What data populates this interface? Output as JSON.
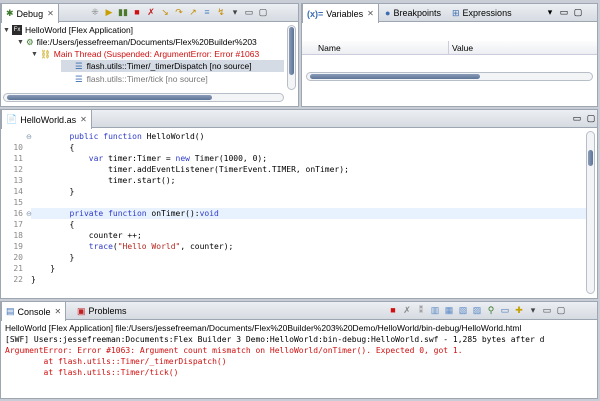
{
  "debug": {
    "tab": "Debug",
    "tree": [
      {
        "text": "HelloWorld [Flex Application]"
      },
      {
        "text": "file:/Users/jessefreeman/Documents/Flex%20Builder%203"
      },
      {
        "text": "Main Thread (Suspended: ArgumentError: Error #1063"
      },
      {
        "text": "flash.utils::Timer/_timerDispatch [no source]"
      },
      {
        "text": "flash.utils::Timer/tick [no source]"
      }
    ]
  },
  "vars": {
    "tabs": [
      "Variables",
      "Breakpoints",
      "Expressions"
    ],
    "col_name": "Name",
    "col_value": "Value"
  },
  "editor": {
    "tab": "HelloWorld.as",
    "lines": [
      {
        "n": "",
        "segs": [
          {
            "t": "        ",
            "c": ""
          },
          {
            "t": "public",
            "c": "kw"
          },
          {
            "t": " ",
            "c": ""
          },
          {
            "t": "function",
            "c": "kw"
          },
          {
            "t": " HelloWorld()",
            "c": ""
          }
        ]
      },
      {
        "n": "10",
        "segs": [
          {
            "t": "        {",
            "c": ""
          }
        ]
      },
      {
        "n": "11",
        "segs": [
          {
            "t": "            ",
            "c": ""
          },
          {
            "t": "var",
            "c": "kw"
          },
          {
            "t": " timer:Timer = ",
            "c": ""
          },
          {
            "t": "new",
            "c": "kw"
          },
          {
            "t": " Timer(1000, 0);",
            "c": ""
          }
        ]
      },
      {
        "n": "12",
        "segs": [
          {
            "t": "                timer.addEventListener(TimerEvent.TIMER, onTimer);",
            "c": ""
          }
        ]
      },
      {
        "n": "13",
        "segs": [
          {
            "t": "                timer.start();",
            "c": ""
          }
        ]
      },
      {
        "n": "14",
        "segs": [
          {
            "t": "        }",
            "c": ""
          }
        ]
      },
      {
        "n": "15",
        "segs": [
          {
            "t": "",
            "c": ""
          }
        ]
      },
      {
        "n": "16",
        "segs": [
          {
            "t": "        ",
            "c": ""
          },
          {
            "t": "private",
            "c": "kw"
          },
          {
            "t": " ",
            "c": ""
          },
          {
            "t": "function",
            "c": "kw"
          },
          {
            "t": " onTimer():",
            "c": ""
          },
          {
            "t": "void",
            "c": "kw"
          }
        ]
      },
      {
        "n": "17",
        "segs": [
          {
            "t": "        {",
            "c": ""
          }
        ]
      },
      {
        "n": "18",
        "segs": [
          {
            "t": "            counter ++;",
            "c": ""
          }
        ]
      },
      {
        "n": "19",
        "segs": [
          {
            "t": "            ",
            "c": ""
          },
          {
            "t": "trace",
            "c": "kw"
          },
          {
            "t": "(",
            "c": ""
          },
          {
            "t": "\"Hello World\"",
            "c": "str"
          },
          {
            "t": ", counter);",
            "c": ""
          }
        ]
      },
      {
        "n": "20",
        "segs": [
          {
            "t": "        }",
            "c": ""
          }
        ]
      },
      {
        "n": "21",
        "segs": [
          {
            "t": "    }",
            "c": ""
          }
        ]
      },
      {
        "n": "22",
        "segs": [
          {
            "t": "}",
            "c": ""
          }
        ]
      }
    ]
  },
  "console": {
    "tabs": [
      "Console",
      "Problems"
    ],
    "header": "HelloWorld [Flex Application] file:/Users/jessefreeman/Documents/Flex%20Builder%203%20Demo/HelloWorld/bin-debug/HelloWorld.html",
    "lines": [
      {
        "text": "[SWF] Users:jessefreeman:Documents:Flex Builder 3 Demo:HelloWorld:bin-debug:HelloWorld.swf - 1,285 bytes after d",
        "color": "#000000"
      },
      {
        "text": "ArgumentError: Error #1063: Argument count mismatch on HelloWorld/onTimer(). Expected 0, got 1.",
        "color": "#d01010"
      },
      {
        "text": "        at flash.utils::Timer/_timerDispatch()",
        "color": "#d01010"
      },
      {
        "text": "        at flash.utils::Timer/tick()",
        "color": "#d01010"
      }
    ]
  },
  "colors": {
    "keyword": "#2f3cc9",
    "string": "#b3261e",
    "error": "#d01010",
    "highlight": "#e8f2fe"
  }
}
